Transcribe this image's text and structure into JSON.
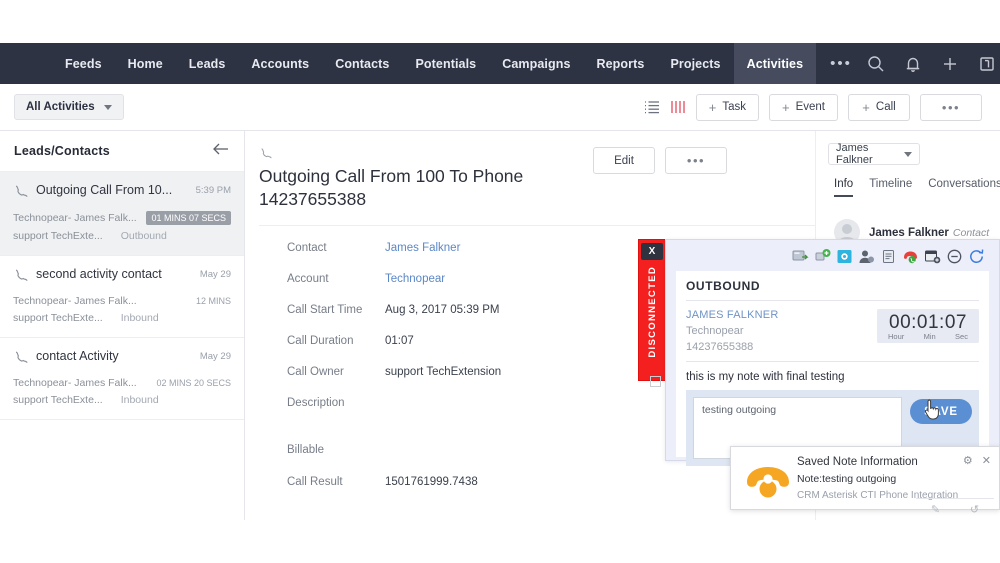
{
  "topnav": {
    "items": [
      {
        "label": "Feeds",
        "active": false
      },
      {
        "label": "Home",
        "active": false
      },
      {
        "label": "Leads",
        "active": false
      },
      {
        "label": "Accounts",
        "active": false
      },
      {
        "label": "Contacts",
        "active": false
      },
      {
        "label": "Potentials",
        "active": false
      },
      {
        "label": "Campaigns",
        "active": false
      },
      {
        "label": "Reports",
        "active": false
      },
      {
        "label": "Projects",
        "active": false
      },
      {
        "label": "Activities",
        "active": true
      }
    ],
    "more_label": "•••",
    "right_icons": [
      "search-icon",
      "bell-icon",
      "plus-icon",
      "notes-icon",
      "scissors-icon"
    ],
    "background": "#2e3344",
    "active_background": "#464c5e"
  },
  "subbar": {
    "filter_label": "All Activities",
    "buttons": [
      {
        "label": "Task",
        "plus": "+"
      },
      {
        "label": "Event",
        "plus": "+"
      },
      {
        "label": "Call",
        "plus": "+"
      }
    ],
    "more_label": "•••",
    "view_icons": [
      "list-view-icon",
      "kanban-view-icon"
    ],
    "kanban_color": "#f08a96"
  },
  "left_panel": {
    "title": "Leads/Contacts",
    "back_icon": "arrow-left-icon",
    "items": [
      {
        "name": "Outgoing Call From 10...",
        "when": "5:39 PM",
        "account_contact": "Technopear- James Falk...",
        "duration": "01 MINS 07 SECS",
        "duration_badge": true,
        "owner": "support TechExte...",
        "direction": "Outbound",
        "selected": true
      },
      {
        "name": "second activity contact",
        "when": "May 29",
        "account_contact": "Technopear- James Falk...",
        "duration": "12 MINS",
        "duration_badge": false,
        "owner": "support TechExte...",
        "direction": "Inbound",
        "selected": false
      },
      {
        "name": "contact Activity",
        "when": "May 29",
        "account_contact": "Technopear- James Falk...",
        "duration": "02 MINS 20 SECS",
        "duration_badge": false,
        "owner": "support TechExte...",
        "direction": "Inbound",
        "selected": false
      }
    ]
  },
  "detail": {
    "title": "Outgoing Call From 100 To Phone 14237655388",
    "phone_icon": "phone-icon",
    "edit_label": "Edit",
    "more_label": "•••",
    "fields": [
      {
        "label": "Contact",
        "value": "James Falkner",
        "link": true
      },
      {
        "label": "Account",
        "value": "Technopear",
        "link": true
      },
      {
        "label": "Call Start Time",
        "value": "Aug 3, 2017 05:39 PM",
        "link": false
      },
      {
        "label": "Call Duration",
        "value": "01:07",
        "link": false
      },
      {
        "label": "Call Owner",
        "value": "support TechExtension",
        "link": false
      },
      {
        "label": "Description",
        "value": "",
        "link": false
      },
      {
        "label": "Billable",
        "value": "",
        "link": false
      },
      {
        "label": "Call Result",
        "value": "1501761999.7438",
        "link": false
      }
    ]
  },
  "right_panel": {
    "selector": "James Falkner",
    "tabs": [
      {
        "label": "Info",
        "active": true
      },
      {
        "label": "Timeline",
        "active": false
      },
      {
        "label": "Conversations",
        "active": false
      }
    ],
    "person_name": "James Falkner",
    "person_role": "Contact",
    "avatar": "avatar-icon"
  },
  "cti": {
    "direction": "OUTBOUND",
    "contact_name": "JAMES FALKNER",
    "account": "Technopear",
    "phone": "14237655388",
    "timer": {
      "value": "00:01:07",
      "labels": [
        "Hour",
        "Min",
        "Sec"
      ]
    },
    "saved_note": "this is my note with final testing",
    "note_value": "testing outgoing",
    "save_label": "SAVE",
    "icons": [
      "transfer-call-icon",
      "add-lead-icon",
      "add-contact-icon",
      "user-profile-icon",
      "notes-icon",
      "end-call-icon",
      "schedule-event-icon",
      "minimize-icon",
      "refresh-icon"
    ],
    "accent": "#5b8fd4"
  },
  "disconnected": {
    "label": "DISCONNECTED",
    "close_label": "X",
    "color": "#f42020"
  },
  "toast": {
    "title": "Saved Note Information",
    "subtitle": "Note:testing outgoing",
    "footer": "CRM Asterisk CTI Phone Integration",
    "icon": "phone-handset-icon",
    "icon_color": "#f5a623",
    "settings_icon": "gear-icon",
    "close_icon": "close-icon"
  },
  "bottom_icons": [
    "compose-icon",
    "history-icon"
  ]
}
